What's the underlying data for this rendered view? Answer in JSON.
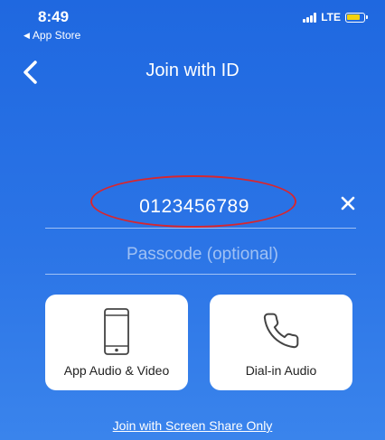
{
  "status_bar": {
    "time": "8:49",
    "back_app": "App Store",
    "network": "LTE",
    "battery_color": "#f5d20d"
  },
  "nav": {
    "title": "Join with ID",
    "back_icon": "chevron-left-icon"
  },
  "form": {
    "meeting_id_value": "0123456789",
    "clear_icon": "close-icon",
    "passcode_placeholder": "Passcode (optional)"
  },
  "options": [
    {
      "label": "App Audio & Video",
      "icon": "phone-device-icon"
    },
    {
      "label": "Dial-in Audio",
      "icon": "phone-handset-icon"
    }
  ],
  "footer": {
    "screen_share_link": "Join with Screen Share Only"
  },
  "colors": {
    "background": "#2b74e6",
    "annotation_oval": "#d8262e"
  }
}
